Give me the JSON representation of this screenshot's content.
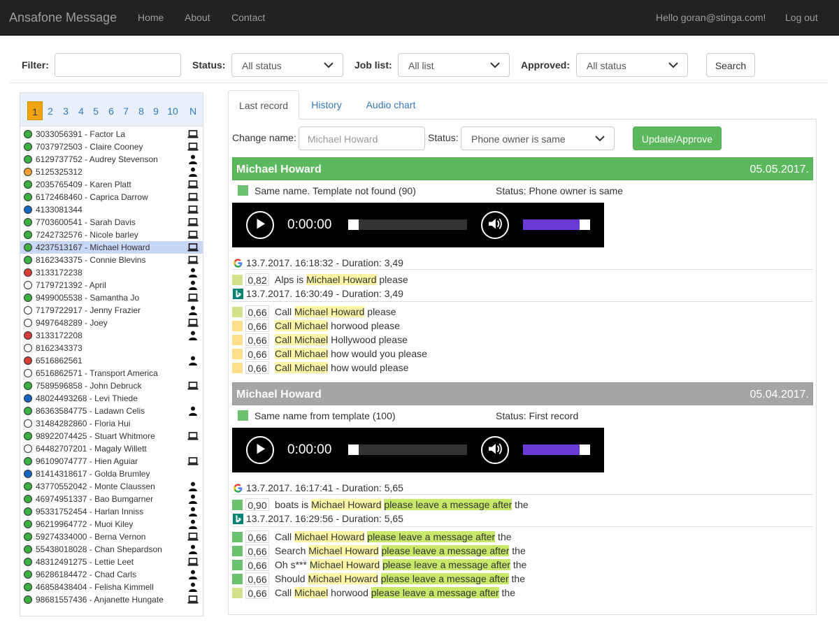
{
  "navbar": {
    "brand": "Ansafone Message",
    "links": [
      "Home",
      "About",
      "Contact"
    ],
    "greeting": "Hello goran@stinga.com!",
    "logout": "Log out"
  },
  "filters": {
    "filter_label": "Filter:",
    "filter_value": "",
    "status_label": "Status:",
    "status_value": "All status",
    "joblist_label": "Job list:",
    "joblist_value": "All list",
    "approved_label": "Approved:",
    "approved_value": "All status",
    "search_button": "Search"
  },
  "pager": {
    "pages": [
      "1",
      "2",
      "3",
      "4",
      "5",
      "6",
      "7",
      "8",
      "9",
      "10",
      "N"
    ],
    "active": "1"
  },
  "contacts": [
    {
      "text": "3033056391 - Factor La",
      "status": "green",
      "icon": "laptop-icon"
    },
    {
      "text": "7037972503 - Claire Cooney",
      "status": "green",
      "icon": "laptop-icon"
    },
    {
      "text": "6129737752 - Audrey Stevenson",
      "status": "green",
      "icon": "person-icon"
    },
    {
      "text": "5125325312",
      "status": "orange",
      "icon": "person-icon"
    },
    {
      "text": "2035765409 - Karen Platt",
      "status": "green",
      "icon": "laptop-icon"
    },
    {
      "text": "6172468460 - Caprica Darrow",
      "status": "green",
      "icon": "laptop-icon"
    },
    {
      "text": "4133081344",
      "status": "blue",
      "icon": "laptop-icon"
    },
    {
      "text": "7703600541 - Sarah Davis",
      "status": "green",
      "icon": "laptop-icon"
    },
    {
      "text": "7242732576 - Nicole barley",
      "status": "green",
      "icon": "laptop-icon"
    },
    {
      "text": "4237513167 - Michael Howard",
      "status": "green",
      "icon": "laptop-icon",
      "selected": true
    },
    {
      "text": "8162343375 - Connie Blevins",
      "status": "green",
      "icon": "laptop-icon"
    },
    {
      "text": "3133172238",
      "status": "red",
      "icon": "person-icon"
    },
    {
      "text": "7179721392 - April",
      "status": "empty",
      "icon": "person-icon"
    },
    {
      "text": "9499005538 - Samantha Jo",
      "status": "green",
      "icon": "laptop-icon"
    },
    {
      "text": "7179722917 - Jenny Frazier",
      "status": "empty",
      "icon": "person-icon"
    },
    {
      "text": "9497648289 - Joey",
      "status": "empty",
      "icon": "laptop-icon"
    },
    {
      "text": "3133172208",
      "status": "red",
      "icon": "person-icon"
    },
    {
      "text": "8162343373",
      "status": "empty",
      "icon": ""
    },
    {
      "text": "6516862561",
      "status": "red",
      "icon": "person-icon"
    },
    {
      "text": "6516862571 - Transport America",
      "status": "empty",
      "icon": ""
    },
    {
      "text": "7589596858 - John Debruck",
      "status": "green",
      "icon": "laptop-icon"
    },
    {
      "text": "48024493268 - Levi Thiede",
      "status": "blue",
      "icon": ""
    },
    {
      "text": "86363584775 - Ladawn Celis",
      "status": "green",
      "icon": "person-icon"
    },
    {
      "text": "31484282860 - Floria Hui",
      "status": "empty",
      "icon": ""
    },
    {
      "text": "98922074425 - Stuart Whitmore",
      "status": "green",
      "icon": "laptop-icon"
    },
    {
      "text": "64482707201 - Magaly Willett",
      "status": "empty",
      "icon": ""
    },
    {
      "text": "96109074777 - Hien Aguiar",
      "status": "green",
      "icon": "laptop-icon"
    },
    {
      "text": "81414318617 - Golda Brumley",
      "status": "blue",
      "icon": ""
    },
    {
      "text": "43770552042 - Monte Claussen",
      "status": "green",
      "icon": "person-icon"
    },
    {
      "text": "46974951337 - Bao Bumgarner",
      "status": "green",
      "icon": "person-icon"
    },
    {
      "text": "95331752454 - Harlan Inniss",
      "status": "green",
      "icon": "person-icon"
    },
    {
      "text": "96219964772 - Muoi Kiley",
      "status": "green",
      "icon": "person-icon"
    },
    {
      "text": "59274334000 - Berna Vernon",
      "status": "green",
      "icon": "laptop-icon"
    },
    {
      "text": "55438018028 - Chan Shepardson",
      "status": "green",
      "icon": "person-icon"
    },
    {
      "text": "48312491275 - Lettie Leet",
      "status": "green",
      "icon": "laptop-icon"
    },
    {
      "text": "96286184472 - Chad Carls",
      "status": "green",
      "icon": "person-icon"
    },
    {
      "text": "46858438404 - Felisha Kimmell",
      "status": "green",
      "icon": "person-icon"
    },
    {
      "text": "98681557436 - Anjanette Hungate",
      "status": "green",
      "icon": "laptop-icon"
    }
  ],
  "tabs": [
    "Last record",
    "History",
    "Audio chart"
  ],
  "form": {
    "change_name_label": "Change name:",
    "change_name_placeholder": "Michael Howard",
    "status_label": "Status:",
    "status_value": "Phone owner is same",
    "update_button": "Update/Approve"
  },
  "records": [
    {
      "name": "Michael Howard",
      "date": "05.05.2017.",
      "header_color": "#5cb85c",
      "match": "Same name. Template not found (90)",
      "status": "Status: Phone owner is same",
      "player_time": "0:00:00",
      "google_line": "13.7.2017. 16:18:32 - Duration: 3,49",
      "google_result": {
        "score": "0,82",
        "segments": [
          [
            "Alps is ",
            ""
          ],
          [
            "Michael Howard",
            "y"
          ],
          [
            " please",
            ""
          ]
        ]
      },
      "bing_line": "13.7.2017. 16:30:49 - Duration: 3,49",
      "bing_results": [
        {
          "score": "0,66",
          "segments": [
            [
              "Call ",
              ""
            ],
            [
              "Michael Howard",
              "y"
            ],
            [
              " please",
              ""
            ]
          ]
        },
        {
          "score": "0,66",
          "segments": [
            [
              "Call Michael",
              "y"
            ],
            [
              " horwood please",
              ""
            ]
          ]
        },
        {
          "score": "0,66",
          "segments": [
            [
              "Call Michael",
              "y"
            ],
            [
              " Hollywood please",
              ""
            ]
          ]
        },
        {
          "score": "0,66",
          "segments": [
            [
              "Call Michael",
              "y"
            ],
            [
              " how would you please",
              ""
            ]
          ]
        },
        {
          "score": "0,66",
          "segments": [
            [
              "Call Michael",
              "y"
            ],
            [
              " how would please",
              ""
            ]
          ]
        }
      ]
    },
    {
      "name": "Michael Howard",
      "date": "05.04.2017.",
      "header_color": "#a5a5a5",
      "match": "Same name from template (100)",
      "status": "Status: First record",
      "player_time": "0:00:00",
      "google_line": "13.7.2017. 16:17:41 - Duration: 5,65",
      "google_result": {
        "score": "0,90",
        "segments": [
          [
            "boats is ",
            ""
          ],
          [
            "Michael Howard",
            "y"
          ],
          [
            " ",
            ""
          ],
          [
            "please leave a message after",
            "g"
          ],
          [
            " the",
            ""
          ]
        ]
      },
      "bing_line": "13.7.2017. 16:29:56 - Duration: 5,65",
      "bing_results": [
        {
          "score": "0,66",
          "segments": [
            [
              "Call ",
              ""
            ],
            [
              "Michael Howard",
              "y"
            ],
            [
              " ",
              ""
            ],
            [
              "please leave a message after",
              "g"
            ],
            [
              " the",
              ""
            ]
          ]
        },
        {
          "score": "0,66",
          "segments": [
            [
              "Search ",
              ""
            ],
            [
              "Michael Howard",
              "y"
            ],
            [
              " ",
              ""
            ],
            [
              "please leave a message after",
              "g"
            ],
            [
              " the",
              ""
            ]
          ]
        },
        {
          "score": "0,66",
          "segments": [
            [
              "Oh s*** ",
              ""
            ],
            [
              "Michael Howard",
              "y"
            ],
            [
              " ",
              ""
            ],
            [
              "please leave a message after",
              "g"
            ],
            [
              " the",
              ""
            ]
          ]
        },
        {
          "score": "0,66",
          "segments": [
            [
              "Should ",
              ""
            ],
            [
              "Michael Howard",
              "y"
            ],
            [
              " ",
              ""
            ],
            [
              "please leave a message after",
              "g"
            ],
            [
              " the",
              ""
            ]
          ]
        },
        {
          "score": "0,66",
          "segments": [
            [
              "Call ",
              ""
            ],
            [
              "Michael",
              "y"
            ],
            [
              " horwood ",
              ""
            ],
            [
              "please leave a message after",
              "g"
            ],
            [
              " the",
              ""
            ]
          ]
        }
      ]
    }
  ],
  "colors": {
    "green": "#3cb043",
    "orange": "#f0a030",
    "blue": "#1565c0",
    "red": "#d43f3a",
    "score_square_green": "#6cc070",
    "score_square_yellow": "#ffe08a",
    "score_square_lime": "#d4e08a",
    "volume_fill": "#6a3ad6"
  },
  "player": {
    "volume_level": 0.84,
    "progress": 0
  }
}
